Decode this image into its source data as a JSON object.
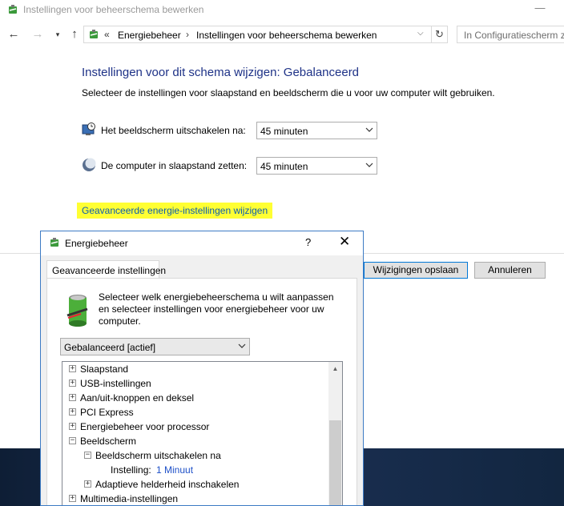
{
  "window": {
    "title": "Instellingen voor beheerschema bewerken",
    "minimize_glyph": "—"
  },
  "nav": {
    "back_glyph": "←",
    "forward_glyph": "→",
    "history_glyph": "▾",
    "up_glyph": "↑",
    "address_chevron": "«",
    "breadcrumb": [
      "Energiebeheer",
      "Instellingen voor beheerschema bewerken"
    ],
    "breadcrumb_sep": "›",
    "dropdown_glyph": "⌵",
    "refresh_glyph": "↻",
    "search_placeholder": "In Configuratiescherm z"
  },
  "main": {
    "heading": "Instellingen voor dit schema wijzigen: Gebalanceerd",
    "description": "Selecteer de instellingen voor slaapstand en beeldscherm die u voor uw computer wilt gebruiken.",
    "display_off_label": "Het beeldscherm uitschakelen na:",
    "display_off_value": "45 minuten",
    "sleep_label": "De computer in slaapstand zetten:",
    "sleep_value": "45 minuten",
    "advanced_link": "Geavanceerde energie-instellingen wijzigen",
    "save_button": "Wijzigingen opslaan",
    "cancel_button": "Annuleren",
    "highlight_color": "#ffff33",
    "heading_color": "#1e3287"
  },
  "dialog": {
    "title": "Energiebeheer",
    "help_glyph": "?",
    "close_glyph": "✕",
    "tab_label": "Geavanceerde instellingen",
    "description": "Selecteer welk energiebeheerschema u wilt aanpassen en selecteer instellingen voor energiebeheer voor uw computer.",
    "plan_value": "Gebalanceerd [actief]",
    "tree": [
      {
        "label": "Slaapstand",
        "expander": "+"
      },
      {
        "label": "USB-instellingen",
        "expander": "+"
      },
      {
        "label": "Aan/uit-knoppen en deksel",
        "expander": "+"
      },
      {
        "label": "PCI Express",
        "expander": "+"
      },
      {
        "label": "Energiebeheer voor processor",
        "expander": "+"
      },
      {
        "label": "Beeldscherm",
        "expander": "−"
      },
      {
        "label": "Beeldscherm uitschakelen na",
        "expander": "−"
      },
      {
        "label": "Instelling:",
        "value": "1 Minuut"
      },
      {
        "label": "Adaptieve helderheid inschakelen",
        "expander": "+"
      },
      {
        "label": "Multimedia-instellingen",
        "expander": "+"
      }
    ],
    "scroll_up_glyph": "▲"
  }
}
